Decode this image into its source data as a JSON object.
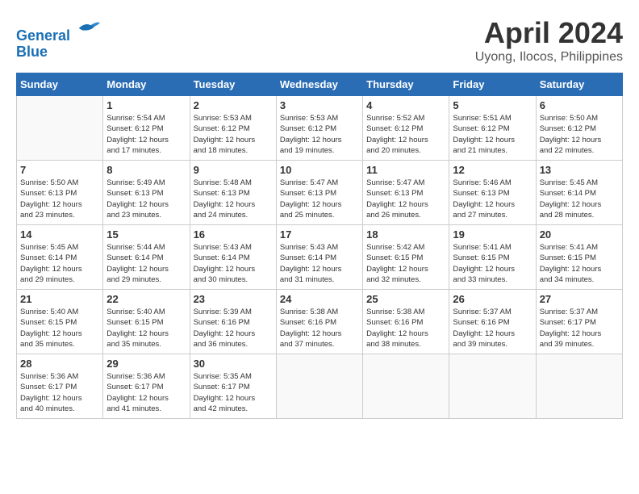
{
  "header": {
    "logo_line1": "General",
    "logo_line2": "Blue",
    "month_title": "April 2024",
    "location": "Uyong, Ilocos, Philippines"
  },
  "days_of_week": [
    "Sunday",
    "Monday",
    "Tuesday",
    "Wednesday",
    "Thursday",
    "Friday",
    "Saturday"
  ],
  "weeks": [
    [
      {
        "day": "",
        "info": ""
      },
      {
        "day": "1",
        "info": "Sunrise: 5:54 AM\nSunset: 6:12 PM\nDaylight: 12 hours\nand 17 minutes."
      },
      {
        "day": "2",
        "info": "Sunrise: 5:53 AM\nSunset: 6:12 PM\nDaylight: 12 hours\nand 18 minutes."
      },
      {
        "day": "3",
        "info": "Sunrise: 5:53 AM\nSunset: 6:12 PM\nDaylight: 12 hours\nand 19 minutes."
      },
      {
        "day": "4",
        "info": "Sunrise: 5:52 AM\nSunset: 6:12 PM\nDaylight: 12 hours\nand 20 minutes."
      },
      {
        "day": "5",
        "info": "Sunrise: 5:51 AM\nSunset: 6:12 PM\nDaylight: 12 hours\nand 21 minutes."
      },
      {
        "day": "6",
        "info": "Sunrise: 5:50 AM\nSunset: 6:12 PM\nDaylight: 12 hours\nand 22 minutes."
      }
    ],
    [
      {
        "day": "7",
        "info": "Sunrise: 5:50 AM\nSunset: 6:13 PM\nDaylight: 12 hours\nand 23 minutes."
      },
      {
        "day": "8",
        "info": "Sunrise: 5:49 AM\nSunset: 6:13 PM\nDaylight: 12 hours\nand 23 minutes."
      },
      {
        "day": "9",
        "info": "Sunrise: 5:48 AM\nSunset: 6:13 PM\nDaylight: 12 hours\nand 24 minutes."
      },
      {
        "day": "10",
        "info": "Sunrise: 5:47 AM\nSunset: 6:13 PM\nDaylight: 12 hours\nand 25 minutes."
      },
      {
        "day": "11",
        "info": "Sunrise: 5:47 AM\nSunset: 6:13 PM\nDaylight: 12 hours\nand 26 minutes."
      },
      {
        "day": "12",
        "info": "Sunrise: 5:46 AM\nSunset: 6:13 PM\nDaylight: 12 hours\nand 27 minutes."
      },
      {
        "day": "13",
        "info": "Sunrise: 5:45 AM\nSunset: 6:14 PM\nDaylight: 12 hours\nand 28 minutes."
      }
    ],
    [
      {
        "day": "14",
        "info": "Sunrise: 5:45 AM\nSunset: 6:14 PM\nDaylight: 12 hours\nand 29 minutes."
      },
      {
        "day": "15",
        "info": "Sunrise: 5:44 AM\nSunset: 6:14 PM\nDaylight: 12 hours\nand 29 minutes."
      },
      {
        "day": "16",
        "info": "Sunrise: 5:43 AM\nSunset: 6:14 PM\nDaylight: 12 hours\nand 30 minutes."
      },
      {
        "day": "17",
        "info": "Sunrise: 5:43 AM\nSunset: 6:14 PM\nDaylight: 12 hours\nand 31 minutes."
      },
      {
        "day": "18",
        "info": "Sunrise: 5:42 AM\nSunset: 6:15 PM\nDaylight: 12 hours\nand 32 minutes."
      },
      {
        "day": "19",
        "info": "Sunrise: 5:41 AM\nSunset: 6:15 PM\nDaylight: 12 hours\nand 33 minutes."
      },
      {
        "day": "20",
        "info": "Sunrise: 5:41 AM\nSunset: 6:15 PM\nDaylight: 12 hours\nand 34 minutes."
      }
    ],
    [
      {
        "day": "21",
        "info": "Sunrise: 5:40 AM\nSunset: 6:15 PM\nDaylight: 12 hours\nand 35 minutes."
      },
      {
        "day": "22",
        "info": "Sunrise: 5:40 AM\nSunset: 6:15 PM\nDaylight: 12 hours\nand 35 minutes."
      },
      {
        "day": "23",
        "info": "Sunrise: 5:39 AM\nSunset: 6:16 PM\nDaylight: 12 hours\nand 36 minutes."
      },
      {
        "day": "24",
        "info": "Sunrise: 5:38 AM\nSunset: 6:16 PM\nDaylight: 12 hours\nand 37 minutes."
      },
      {
        "day": "25",
        "info": "Sunrise: 5:38 AM\nSunset: 6:16 PM\nDaylight: 12 hours\nand 38 minutes."
      },
      {
        "day": "26",
        "info": "Sunrise: 5:37 AM\nSunset: 6:16 PM\nDaylight: 12 hours\nand 39 minutes."
      },
      {
        "day": "27",
        "info": "Sunrise: 5:37 AM\nSunset: 6:17 PM\nDaylight: 12 hours\nand 39 minutes."
      }
    ],
    [
      {
        "day": "28",
        "info": "Sunrise: 5:36 AM\nSunset: 6:17 PM\nDaylight: 12 hours\nand 40 minutes."
      },
      {
        "day": "29",
        "info": "Sunrise: 5:36 AM\nSunset: 6:17 PM\nDaylight: 12 hours\nand 41 minutes."
      },
      {
        "day": "30",
        "info": "Sunrise: 5:35 AM\nSunset: 6:17 PM\nDaylight: 12 hours\nand 42 minutes."
      },
      {
        "day": "",
        "info": ""
      },
      {
        "day": "",
        "info": ""
      },
      {
        "day": "",
        "info": ""
      },
      {
        "day": "",
        "info": ""
      }
    ]
  ]
}
